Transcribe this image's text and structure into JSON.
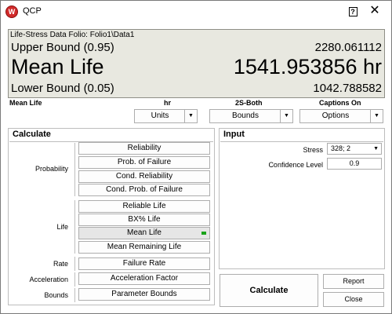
{
  "window": {
    "app_icon_letter": "W",
    "title": "QCP",
    "help_label": "?",
    "close_label": "✕"
  },
  "result": {
    "folio": "Life-Stress Data Folio: Folio1\\Data1",
    "upper_label": "Upper Bound (0.95)",
    "upper_value": "2280.061112",
    "mean_label": "Mean Life",
    "mean_value": "1541.953856 hr",
    "lower_label": "Lower Bound (0.05)",
    "lower_value": "1042.788582"
  },
  "captions": {
    "result_type": "Mean Life",
    "units": "hr",
    "bounds": "2S-Both",
    "captions_state": "Captions On"
  },
  "dropdowns": {
    "units_label": "Units",
    "bounds_label": "Bounds",
    "options_label": "Options"
  },
  "calculate": {
    "title": "Calculate",
    "categories": {
      "probability": "Probability",
      "life": "Life",
      "rate": "Rate",
      "acceleration": "Acceleration",
      "bounds": "Bounds"
    },
    "buttons": {
      "reliability": "Reliability",
      "prob_failure": "Prob. of Failure",
      "cond_reliability": "Cond. Reliability",
      "cond_prob_failure": "Cond. Prob. of Failure",
      "reliable_life": "Reliable Life",
      "bx_life": "BX% Life",
      "mean_life": "Mean Life",
      "mean_remaining_life": "Mean Remaining Life",
      "failure_rate": "Failure Rate",
      "acceleration_factor": "Acceleration Factor",
      "parameter_bounds": "Parameter Bounds"
    },
    "selected_button": "mean_life"
  },
  "input": {
    "title": "Input",
    "stress_label": "Stress",
    "stress_value": "328; 2",
    "confidence_label": "Confidence Level",
    "confidence_value": "0.9"
  },
  "actions": {
    "calculate_label": "Calculate",
    "report_label": "Report",
    "close_label": "Close"
  },
  "colors": {
    "result_bg": "#e8e8e0",
    "selected_indicator": "#1aa31a",
    "app_icon": "#d12a2a"
  }
}
